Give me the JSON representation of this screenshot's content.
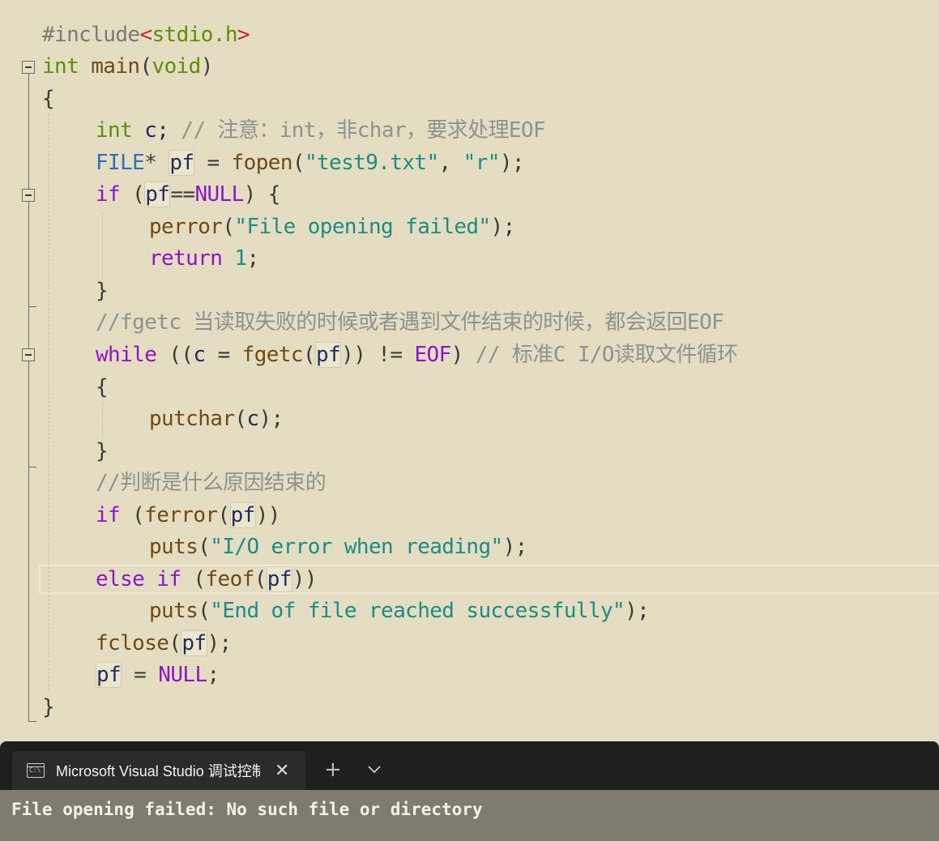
{
  "editor": {
    "lines": {
      "l1": {
        "hash": "#include",
        "lt": "<",
        "file": "stdio.h",
        "gt": ">"
      },
      "l2": {
        "kw": "int",
        "sp": " ",
        "fn": "main",
        "p1": "(",
        "arg": "void",
        "p2": ")"
      },
      "l3": {
        "brace": "{"
      },
      "l4": {
        "kw": "int",
        "rest": " c; ",
        "cm": "// 注意：int，非char，要求处理EOF"
      },
      "l5": {
        "ty": "FILE",
        "star": "* ",
        "var": "pf",
        "eq": " = ",
        "fn": "fopen",
        "p1": "(",
        "s1": "\"test9.txt\"",
        "comma": ", ",
        "s2": "\"r\"",
        "end": ");"
      },
      "l6": {
        "kw": "if",
        "p1": " (",
        "var": "pf",
        "op": "==",
        "mac": "NULL",
        "end": ") {"
      },
      "l7": {
        "fn": "perror",
        "p1": "(",
        "str": "\"File opening failed\"",
        "end": ");"
      },
      "l8": {
        "kw": "return",
        "sp": " ",
        "num": "1",
        "end": ";"
      },
      "l9": {
        "brace": "}"
      },
      "l10": {
        "cm": "//fgetc 当读取失败的时候或者遇到文件结束的时候，都会返回EOF"
      },
      "l11": {
        "kw": "while",
        "p1": " ((",
        "c": "c",
        "eq": " = ",
        "fn": "fgetc",
        "p2": "(",
        "var": "pf",
        "p3": ")) != ",
        "mac": "EOF",
        "p4": ") ",
        "cm": "// 标准C I/O读取文件循环"
      },
      "l12": {
        "brace": "{"
      },
      "l13": {
        "fn": "putchar",
        "p1": "(",
        "c": "c",
        "end": ");"
      },
      "l14": {
        "brace": "}"
      },
      "l15": {
        "cm": "//判断是什么原因结束的"
      },
      "l16": {
        "kw": "if",
        "p1": " (",
        "fn": "ferror",
        "p2": "(",
        "var": "pf",
        "end": "))"
      },
      "l17": {
        "fn": "puts",
        "p1": "(",
        "str": "\"I/O error when reading\"",
        "end": ");"
      },
      "l18": {
        "kw": "else if",
        "p1": " (",
        "fn": "feof",
        "p2": "(",
        "var": "pf",
        "end": "))"
      },
      "l19": {
        "fn": "puts",
        "p1": "(",
        "str": "\"End of file reached successfully\"",
        "end": ");"
      },
      "l20": {
        "fn": "fclose",
        "p1": "(",
        "var": "pf",
        "end": ");"
      },
      "l21": {
        "var": "pf",
        "eq": " = ",
        "mac": "NULL",
        "end": ";"
      },
      "l22": {
        "brace": "}"
      }
    }
  },
  "console": {
    "tab_icon": "console-window-icon",
    "tab_icon_text": "C:\\",
    "tab_title": "Microsoft Visual Studio 调试控制台",
    "close_glyph": "✕",
    "new_tab_glyph": "+",
    "output": "File opening failed: No such file or directory"
  },
  "colors": {
    "editor_bg": "#e5ddc1",
    "keyword": "#8a16c5",
    "string": "#1c8c86",
    "comment": "#8e9290",
    "function": "#6f4a16",
    "console_bg": "#7f7b6e",
    "tabbar_bg": "#1f1f1f"
  }
}
